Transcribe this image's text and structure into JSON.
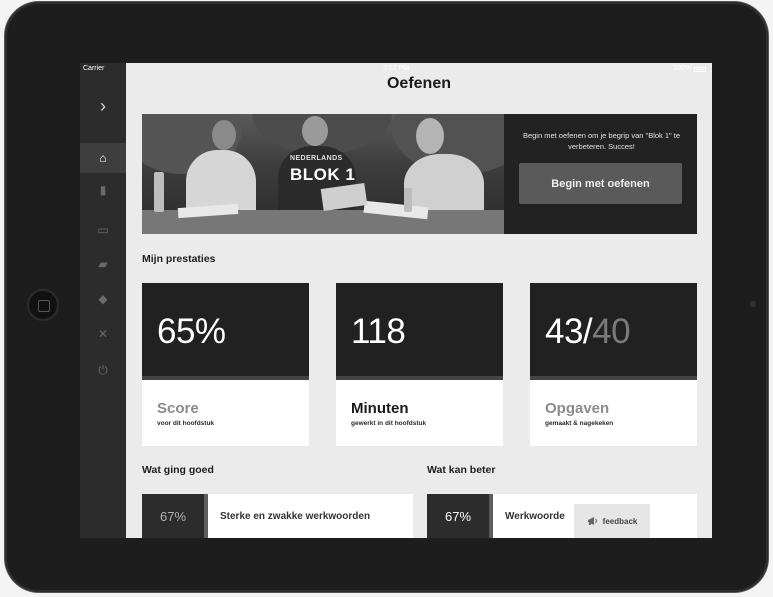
{
  "statusbar": {
    "carrier": "Carrier",
    "time": "3:52 PM",
    "battery": "100%"
  },
  "header": {
    "title": "Oefenen"
  },
  "sidebar": {
    "items": [
      {
        "name": "chevron",
        "icon": "chevron-right-icon",
        "glyph": "›"
      },
      {
        "name": "home",
        "icon": "home-icon",
        "glyph": "⌂"
      },
      {
        "name": "book",
        "icon": "book-icon",
        "glyph": "▮"
      },
      {
        "name": "toolbox",
        "icon": "toolbox-icon",
        "glyph": "▭"
      },
      {
        "name": "chat",
        "icon": "chat-icon",
        "glyph": "▰"
      },
      {
        "name": "badge",
        "icon": "badge-icon",
        "glyph": "◆"
      },
      {
        "name": "tools",
        "icon": "tools-icon",
        "glyph": "✕"
      },
      {
        "name": "power",
        "icon": "power-icon",
        "glyph": "⏻"
      }
    ]
  },
  "hero": {
    "subject": "NEDERLANDS",
    "block": "BLOK 1",
    "text": "Begin met oefenen om je begrip van \"Blok 1\" te verbeteren. Succes!",
    "button": "Begin met oefenen"
  },
  "stats": {
    "title": "Mijn prestaties",
    "cards": [
      {
        "value": "65%",
        "label": "Score",
        "sub": "voor dit hoofdstuk"
      },
      {
        "value": "118",
        "label": "Minuten",
        "sub": "gewerkt in dit hoofdstuk"
      },
      {
        "value": "43/",
        "value_dim": "40",
        "label": "Opgaven",
        "sub": "gemaakt & nagekeken"
      }
    ]
  },
  "good": {
    "title": "Wat ging goed",
    "items": [
      {
        "pct": "67%",
        "label": "Sterke en zwakke werkwoorden"
      }
    ]
  },
  "better": {
    "title": "Wat kan beter",
    "items": [
      {
        "pct": "67%",
        "label": "Werkwoorde"
      }
    ]
  },
  "feedback": {
    "label": "feedback",
    "icon": "megaphone-icon"
  },
  "colors": {
    "dark": "#212121",
    "background": "#ebebeb",
    "card": "#ffffff"
  }
}
